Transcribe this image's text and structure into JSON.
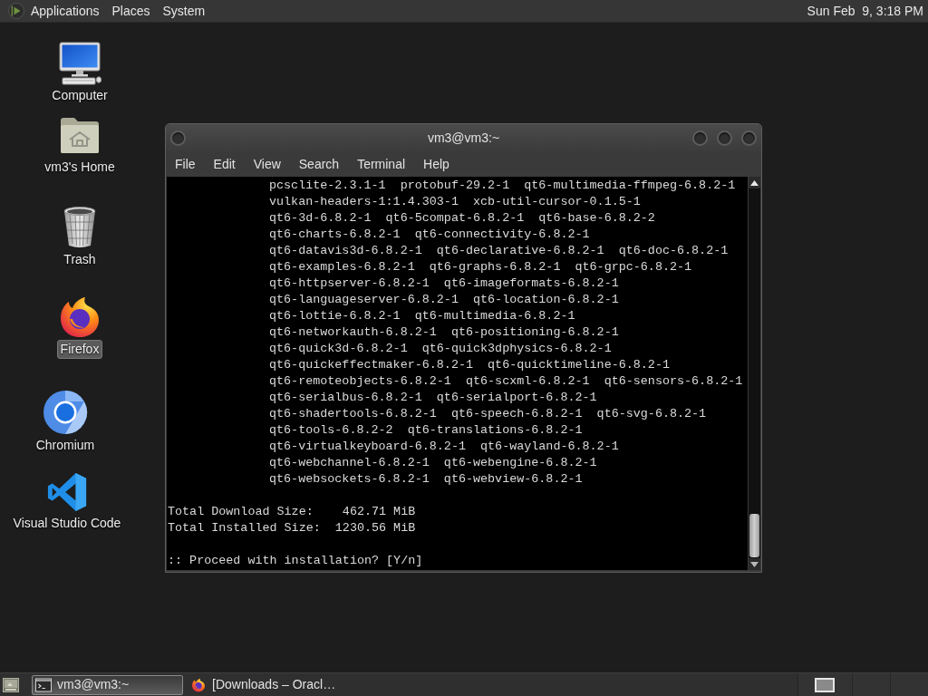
{
  "top_panel": {
    "menus": [
      "Applications",
      "Places",
      "System"
    ],
    "clock": "Sun Feb  9, 3:18 PM"
  },
  "desktop_icons": [
    {
      "label": "Computer",
      "kind": "computer",
      "selected": false
    },
    {
      "label": "vm3's Home",
      "kind": "home",
      "selected": false
    },
    {
      "label": "Trash",
      "kind": "trash",
      "selected": false
    },
    {
      "label": "Firefox",
      "kind": "firefox",
      "selected": true
    },
    {
      "label": "Chromium",
      "kind": "chromium",
      "selected": false
    },
    {
      "label": "Visual Studio Code",
      "kind": "vscode",
      "selected": false
    }
  ],
  "terminal_window": {
    "title": "vm3@vm3:~",
    "menu": [
      "File",
      "Edit",
      "View",
      "Search",
      "Terminal",
      "Help"
    ],
    "package_lines": [
      "pcsclite-2.3.1-1  protobuf-29.2-1  qt6-multimedia-ffmpeg-6.8.2-1",
      "vulkan-headers-1:1.4.303-1  xcb-util-cursor-0.1.5-1",
      "qt6-3d-6.8.2-1  qt6-5compat-6.8.2-1  qt6-base-6.8.2-2",
      "qt6-charts-6.8.2-1  qt6-connectivity-6.8.2-1",
      "qt6-datavis3d-6.8.2-1  qt6-declarative-6.8.2-1  qt6-doc-6.8.2-1",
      "qt6-examples-6.8.2-1  qt6-graphs-6.8.2-1  qt6-grpc-6.8.2-1",
      "qt6-httpserver-6.8.2-1  qt6-imageformats-6.8.2-1",
      "qt6-languageserver-6.8.2-1  qt6-location-6.8.2-1",
      "qt6-lottie-6.8.2-1  qt6-multimedia-6.8.2-1",
      "qt6-networkauth-6.8.2-1  qt6-positioning-6.8.2-1",
      "qt6-quick3d-6.8.2-1  qt6-quick3dphysics-6.8.2-1",
      "qt6-quickeffectmaker-6.8.2-1  qt6-quicktimeline-6.8.2-1",
      "qt6-remoteobjects-6.8.2-1  qt6-scxml-6.8.2-1  qt6-sensors-6.8.2-1",
      "qt6-serialbus-6.8.2-1  qt6-serialport-6.8.2-1",
      "qt6-shadertools-6.8.2-1  qt6-speech-6.8.2-1  qt6-svg-6.8.2-1",
      "qt6-tools-6.8.2-2  qt6-translations-6.8.2-1",
      "qt6-virtualkeyboard-6.8.2-1  qt6-wayland-6.8.2-1",
      "qt6-webchannel-6.8.2-1  qt6-webengine-6.8.2-1",
      "qt6-websockets-6.8.2-1  qt6-webview-6.8.2-1"
    ],
    "summary_lines": [
      "Total Download Size:    462.71 MiB",
      "Total Installed Size:  1230.56 MiB"
    ],
    "prompt": ":: Proceed with installation? [Y/n]"
  },
  "bottom_panel": {
    "tasks": [
      {
        "label": "vm3@vm3:~",
        "kind": "terminal",
        "selected": true
      },
      {
        "label": "[Downloads – Oracl…",
        "kind": "firefox",
        "selected": false
      }
    ]
  }
}
